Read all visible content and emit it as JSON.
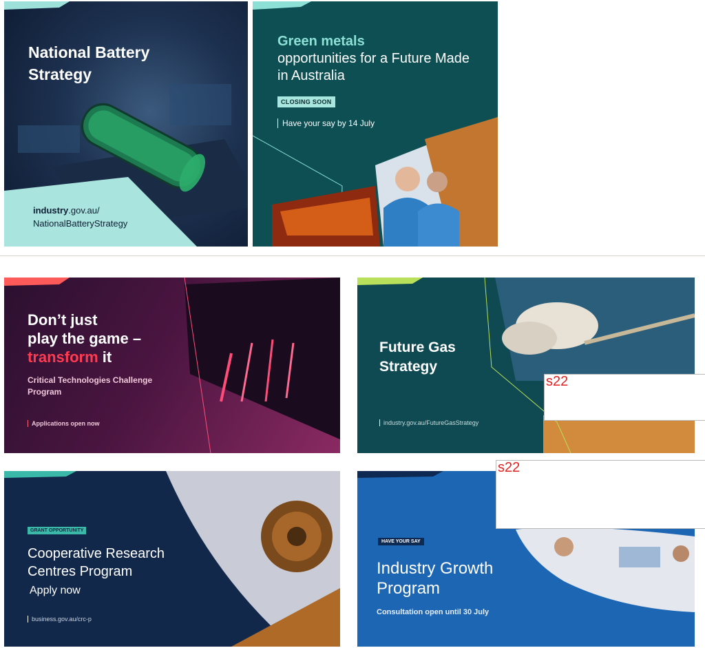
{
  "tiles": {
    "battery": {
      "title": "National Battery Strategy",
      "url_domain": "industry",
      "url_rest": ".gov.au/",
      "url_path": "NationalBatteryStrategy"
    },
    "green_metals": {
      "title_highlight": "Green metals",
      "title_rest": "opportunities for a Future Made in Australia",
      "badge": "CLOSING SOON",
      "deadline": "Have your say by 14 July"
    },
    "critical_tech": {
      "title_line1": "Don’t just",
      "title_line2": "play the game –",
      "title_red": "transform",
      "title_end": " it",
      "subtitle": "Critical Technologies Challenge Program",
      "status": "Applications open now"
    },
    "future_gas": {
      "title": "Future Gas Strategy",
      "url": "industry.gov.au/FutureGasStrategy"
    },
    "crc": {
      "badge": "GRANT OPPORTUNITY",
      "title": "Cooperative Research Centres Program",
      "cta": "Apply now",
      "url": "business.gov.au/crc-p"
    },
    "growth": {
      "badge": "HAVE YOUR SAY",
      "title": "Industry Growth Program",
      "subtitle": "Consultation open until 30 July"
    }
  },
  "redactions": [
    {
      "label": "s22"
    },
    {
      "label": "s22"
    }
  ],
  "colors": {
    "teal_accent": "#8de0d6",
    "red_accent": "#ff3b52",
    "redaction_text": "#e32020"
  }
}
